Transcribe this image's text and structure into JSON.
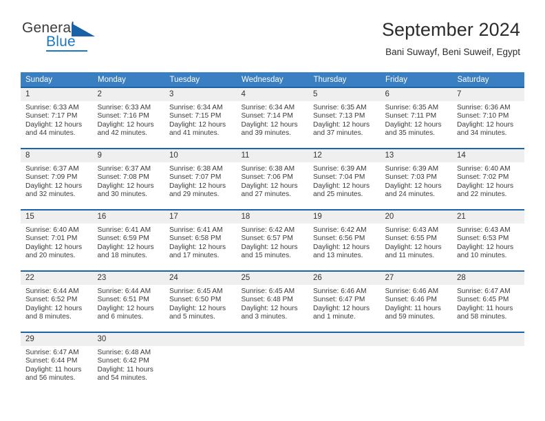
{
  "brand": {
    "name_part1": "General",
    "name_part2": "Blue",
    "flag_icon": "blue-triangle-flag"
  },
  "header": {
    "month_title": "September 2024",
    "location": "Bani Suwayf, Beni Suweif, Egypt"
  },
  "colors": {
    "header_blue": "#3a7fc1",
    "cell_top_border": "#1a62a8",
    "brand_blue": "#1878c4",
    "daynum_bg": "#efefef"
  },
  "calendar": {
    "weekday_headers": [
      "Sunday",
      "Monday",
      "Tuesday",
      "Wednesday",
      "Thursday",
      "Friday",
      "Saturday"
    ],
    "weeks": [
      [
        {
          "day": "1",
          "sunrise": "Sunrise: 6:33 AM",
          "sunset": "Sunset: 7:17 PM",
          "daylight_line1": "Daylight: 12 hours",
          "daylight_line2": "and 44 minutes."
        },
        {
          "day": "2",
          "sunrise": "Sunrise: 6:33 AM",
          "sunset": "Sunset: 7:16 PM",
          "daylight_line1": "Daylight: 12 hours",
          "daylight_line2": "and 42 minutes."
        },
        {
          "day": "3",
          "sunrise": "Sunrise: 6:34 AM",
          "sunset": "Sunset: 7:15 PM",
          "daylight_line1": "Daylight: 12 hours",
          "daylight_line2": "and 41 minutes."
        },
        {
          "day": "4",
          "sunrise": "Sunrise: 6:34 AM",
          "sunset": "Sunset: 7:14 PM",
          "daylight_line1": "Daylight: 12 hours",
          "daylight_line2": "and 39 minutes."
        },
        {
          "day": "5",
          "sunrise": "Sunrise: 6:35 AM",
          "sunset": "Sunset: 7:13 PM",
          "daylight_line1": "Daylight: 12 hours",
          "daylight_line2": "and 37 minutes."
        },
        {
          "day": "6",
          "sunrise": "Sunrise: 6:35 AM",
          "sunset": "Sunset: 7:11 PM",
          "daylight_line1": "Daylight: 12 hours",
          "daylight_line2": "and 35 minutes."
        },
        {
          "day": "7",
          "sunrise": "Sunrise: 6:36 AM",
          "sunset": "Sunset: 7:10 PM",
          "daylight_line1": "Daylight: 12 hours",
          "daylight_line2": "and 34 minutes."
        }
      ],
      [
        {
          "day": "8",
          "sunrise": "Sunrise: 6:37 AM",
          "sunset": "Sunset: 7:09 PM",
          "daylight_line1": "Daylight: 12 hours",
          "daylight_line2": "and 32 minutes."
        },
        {
          "day": "9",
          "sunrise": "Sunrise: 6:37 AM",
          "sunset": "Sunset: 7:08 PM",
          "daylight_line1": "Daylight: 12 hours",
          "daylight_line2": "and 30 minutes."
        },
        {
          "day": "10",
          "sunrise": "Sunrise: 6:38 AM",
          "sunset": "Sunset: 7:07 PM",
          "daylight_line1": "Daylight: 12 hours",
          "daylight_line2": "and 29 minutes."
        },
        {
          "day": "11",
          "sunrise": "Sunrise: 6:38 AM",
          "sunset": "Sunset: 7:06 PM",
          "daylight_line1": "Daylight: 12 hours",
          "daylight_line2": "and 27 minutes."
        },
        {
          "day": "12",
          "sunrise": "Sunrise: 6:39 AM",
          "sunset": "Sunset: 7:04 PM",
          "daylight_line1": "Daylight: 12 hours",
          "daylight_line2": "and 25 minutes."
        },
        {
          "day": "13",
          "sunrise": "Sunrise: 6:39 AM",
          "sunset": "Sunset: 7:03 PM",
          "daylight_line1": "Daylight: 12 hours",
          "daylight_line2": "and 24 minutes."
        },
        {
          "day": "14",
          "sunrise": "Sunrise: 6:40 AM",
          "sunset": "Sunset: 7:02 PM",
          "daylight_line1": "Daylight: 12 hours",
          "daylight_line2": "and 22 minutes."
        }
      ],
      [
        {
          "day": "15",
          "sunrise": "Sunrise: 6:40 AM",
          "sunset": "Sunset: 7:01 PM",
          "daylight_line1": "Daylight: 12 hours",
          "daylight_line2": "and 20 minutes."
        },
        {
          "day": "16",
          "sunrise": "Sunrise: 6:41 AM",
          "sunset": "Sunset: 6:59 PM",
          "daylight_line1": "Daylight: 12 hours",
          "daylight_line2": "and 18 minutes."
        },
        {
          "day": "17",
          "sunrise": "Sunrise: 6:41 AM",
          "sunset": "Sunset: 6:58 PM",
          "daylight_line1": "Daylight: 12 hours",
          "daylight_line2": "and 17 minutes."
        },
        {
          "day": "18",
          "sunrise": "Sunrise: 6:42 AM",
          "sunset": "Sunset: 6:57 PM",
          "daylight_line1": "Daylight: 12 hours",
          "daylight_line2": "and 15 minutes."
        },
        {
          "day": "19",
          "sunrise": "Sunrise: 6:42 AM",
          "sunset": "Sunset: 6:56 PM",
          "daylight_line1": "Daylight: 12 hours",
          "daylight_line2": "and 13 minutes."
        },
        {
          "day": "20",
          "sunrise": "Sunrise: 6:43 AM",
          "sunset": "Sunset: 6:55 PM",
          "daylight_line1": "Daylight: 12 hours",
          "daylight_line2": "and 11 minutes."
        },
        {
          "day": "21",
          "sunrise": "Sunrise: 6:43 AM",
          "sunset": "Sunset: 6:53 PM",
          "daylight_line1": "Daylight: 12 hours",
          "daylight_line2": "and 10 minutes."
        }
      ],
      [
        {
          "day": "22",
          "sunrise": "Sunrise: 6:44 AM",
          "sunset": "Sunset: 6:52 PM",
          "daylight_line1": "Daylight: 12 hours",
          "daylight_line2": "and 8 minutes."
        },
        {
          "day": "23",
          "sunrise": "Sunrise: 6:44 AM",
          "sunset": "Sunset: 6:51 PM",
          "daylight_line1": "Daylight: 12 hours",
          "daylight_line2": "and 6 minutes."
        },
        {
          "day": "24",
          "sunrise": "Sunrise: 6:45 AM",
          "sunset": "Sunset: 6:50 PM",
          "daylight_line1": "Daylight: 12 hours",
          "daylight_line2": "and 5 minutes."
        },
        {
          "day": "25",
          "sunrise": "Sunrise: 6:45 AM",
          "sunset": "Sunset: 6:48 PM",
          "daylight_line1": "Daylight: 12 hours",
          "daylight_line2": "and 3 minutes."
        },
        {
          "day": "26",
          "sunrise": "Sunrise: 6:46 AM",
          "sunset": "Sunset: 6:47 PM",
          "daylight_line1": "Daylight: 12 hours",
          "daylight_line2": "and 1 minute."
        },
        {
          "day": "27",
          "sunrise": "Sunrise: 6:46 AM",
          "sunset": "Sunset: 6:46 PM",
          "daylight_line1": "Daylight: 11 hours",
          "daylight_line2": "and 59 minutes."
        },
        {
          "day": "28",
          "sunrise": "Sunrise: 6:47 AM",
          "sunset": "Sunset: 6:45 PM",
          "daylight_line1": "Daylight: 11 hours",
          "daylight_line2": "and 58 minutes."
        }
      ],
      [
        {
          "day": "29",
          "sunrise": "Sunrise: 6:47 AM",
          "sunset": "Sunset: 6:44 PM",
          "daylight_line1": "Daylight: 11 hours",
          "daylight_line2": "and 56 minutes."
        },
        {
          "day": "30",
          "sunrise": "Sunrise: 6:48 AM",
          "sunset": "Sunset: 6:42 PM",
          "daylight_line1": "Daylight: 11 hours",
          "daylight_line2": "and 54 minutes."
        },
        {
          "day": "",
          "sunrise": "",
          "sunset": "",
          "daylight_line1": "",
          "daylight_line2": ""
        },
        {
          "day": "",
          "sunrise": "",
          "sunset": "",
          "daylight_line1": "",
          "daylight_line2": ""
        },
        {
          "day": "",
          "sunrise": "",
          "sunset": "",
          "daylight_line1": "",
          "daylight_line2": ""
        },
        {
          "day": "",
          "sunrise": "",
          "sunset": "",
          "daylight_line1": "",
          "daylight_line2": ""
        },
        {
          "day": "",
          "sunrise": "",
          "sunset": "",
          "daylight_line1": "",
          "daylight_line2": ""
        }
      ]
    ]
  }
}
